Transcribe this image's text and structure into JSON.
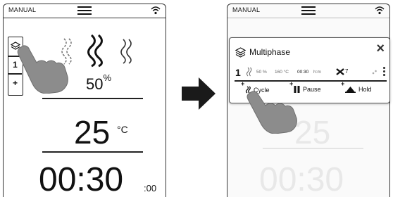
{
  "left_screen": {
    "mode_label": "MANUAL",
    "layers": [
      "1",
      "+"
    ],
    "humidity": {
      "value": "50",
      "unit": "%"
    },
    "temperature": {
      "value": "25",
      "unit": "°C"
    },
    "time": {
      "main": "00:30",
      "seconds": ":00"
    }
  },
  "right_screen": {
    "mode_label": "MANUAL",
    "background": {
      "temperature": "25",
      "time": "00:30"
    },
    "popup": {
      "title": "Multiphase",
      "close": "×",
      "phase": {
        "number": "1",
        "humidity": "50 %",
        "temperature": "160 °C",
        "time_value": "00:30",
        "time_unit": "h:m",
        "fan_speed": "7"
      },
      "actions": [
        {
          "plus": "+",
          "label": "Cycle",
          "icon": "steam-icon"
        },
        {
          "plus": "+",
          "label": "Pause",
          "icon": "pause-icon"
        },
        {
          "plus": "+",
          "label": "Hold",
          "icon": "hold-icon"
        }
      ]
    }
  },
  "icons": [
    "menu-icon",
    "wifi-icon",
    "layers-icon",
    "steam-icon",
    "fan-icon",
    "hand-pointer-icon",
    "arrow-right-icon",
    "close-icon",
    "pause-icon",
    "hold-icon"
  ]
}
